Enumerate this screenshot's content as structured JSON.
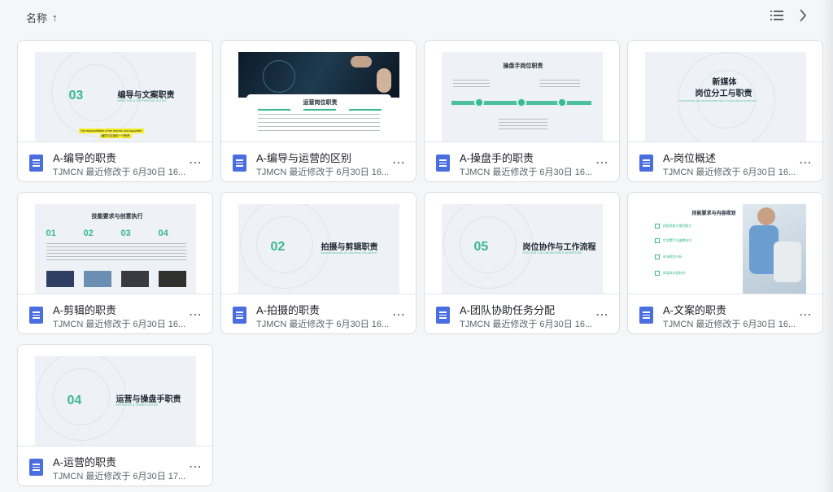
{
  "toolbar": {
    "sort_label": "名称",
    "sort_arrow": "↑"
  },
  "files": [
    {
      "title": "A-编导的职责",
      "subtitle": "TJMCN 最近修改于 6月30日 16...",
      "thumb": {
        "num": "03",
        "heading": "编导与文案职责",
        "tag": "DIRECTOR & COPYWRITER DUTIES",
        "note": "The responsibilities of the director and copywriter",
        "note2": "编导与文案的一个职责"
      }
    },
    {
      "title": "A-编导与运营的区别",
      "subtitle": "TJMCN 最近修改于 6月30日 16...",
      "thumb": {
        "heading": "运营岗位职责"
      }
    },
    {
      "title": "A-操盘手的职责",
      "subtitle": "TJMCN 最近修改于 6月30日 16...",
      "thumb": {
        "heading": "操盘手岗位职责"
      }
    },
    {
      "title": "A-岗位概述",
      "subtitle": "TJMCN 最近修改于 6月30日 16...",
      "thumb": {
        "heading": "新媒体",
        "heading2": "岗位分工与职责",
        "tag": "JOB DIVISION AND RESPONSIBILITIES OF NEW MEDIA POSITIONS"
      }
    },
    {
      "title": "A-剪辑的职责",
      "subtitle": "TJMCN 最近修改于 6月30日 16...",
      "thumb": {
        "heading": "技能要求与创意执行",
        "nums": [
          "01",
          "02",
          "03",
          "04"
        ]
      }
    },
    {
      "title": "A-拍摄的职责",
      "subtitle": "TJMCN 最近修改于 6月30日 16...",
      "thumb": {
        "num": "02",
        "heading": "拍摄与剪辑职责",
        "tag": "RESPONSIBILITIES OF SHOOTING AND EDITING"
      }
    },
    {
      "title": "A-团队协助任务分配",
      "subtitle": "TJMCN 最近修改于 6月30日 16...",
      "thumb": {
        "num": "05",
        "heading": "岗位协作与工作流程",
        "tag": "POSITION COLLABORATION & WORKFLOW"
      }
    },
    {
      "title": "A-文案的职责",
      "subtitle": "TJMCN 最近修改于 6月30日 16...",
      "thumb": {
        "heading": "技能要求与内容规划",
        "items": [
          "创意思维与策划能力",
          "文案撰写与编辑技巧",
          "市场趋势分析",
          "多媒体内容制作"
        ]
      }
    },
    {
      "title": "A-运营的职责",
      "subtitle": "TJMCN 最近修改于 6月30日 17...",
      "thumb": {
        "num": "04",
        "heading": "运营与操盘手职责",
        "tag": "OPERATOR & TRADER DUTIES"
      }
    }
  ],
  "colors": {
    "accent": "#39b98f",
    "doc_icon": "#4a6ee0"
  }
}
